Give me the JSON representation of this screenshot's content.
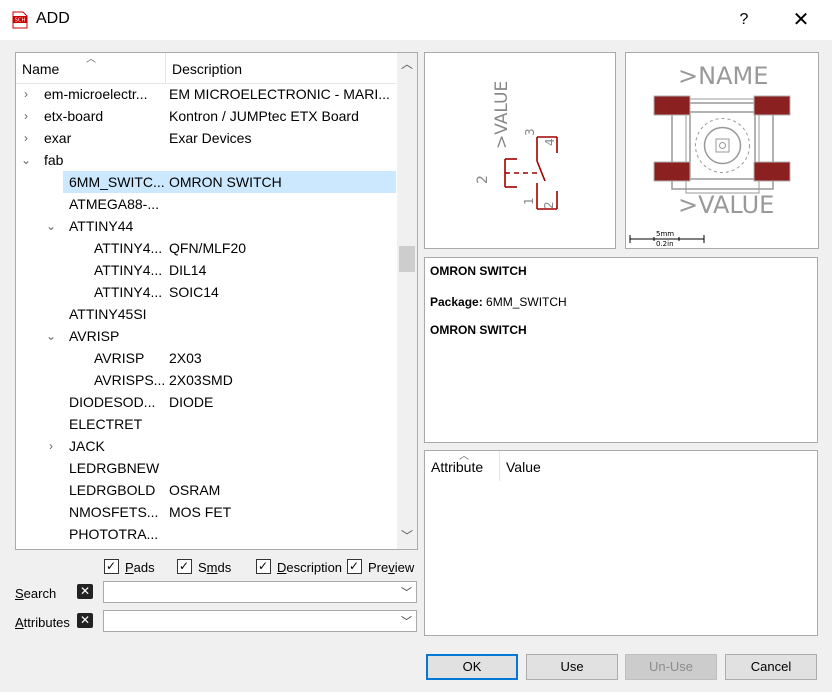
{
  "window": {
    "title": "ADD",
    "help": "?",
    "close": "✕"
  },
  "tree": {
    "col_name": "Name",
    "col_desc": "Description",
    "rows": [
      {
        "name": "em-microelectr...",
        "desc": "EM MICROELECTRONIC - MARI...",
        "indent": 0,
        "exp": "›"
      },
      {
        "name": "etx-board",
        "desc": "Kontron / JUMPtec ETX Board",
        "indent": 0,
        "exp": "›"
      },
      {
        "name": "exar",
        "desc": "Exar Devices",
        "indent": 0,
        "exp": "›"
      },
      {
        "name": "fab",
        "desc": "",
        "indent": 0,
        "exp": "⌄"
      },
      {
        "name": "6MM_SWITC...",
        "desc": "OMRON SWITCH",
        "indent": 1,
        "exp": "",
        "selected": true
      },
      {
        "name": "ATMEGA88-...",
        "desc": "",
        "indent": 1,
        "exp": ""
      },
      {
        "name": "ATTINY44",
        "desc": "",
        "indent": 1,
        "exp": "⌄"
      },
      {
        "name": "ATTINY4...",
        "desc": "QFN/MLF20",
        "indent": 2,
        "exp": ""
      },
      {
        "name": "ATTINY4...",
        "desc": "DIL14",
        "indent": 2,
        "exp": ""
      },
      {
        "name": "ATTINY4...",
        "desc": "SOIC14",
        "indent": 2,
        "exp": ""
      },
      {
        "name": "ATTINY45SI",
        "desc": "",
        "indent": 1,
        "exp": ""
      },
      {
        "name": "AVRISP",
        "desc": "",
        "indent": 1,
        "exp": "⌄"
      },
      {
        "name": "AVRISP",
        "desc": "2X03",
        "indent": 2,
        "exp": ""
      },
      {
        "name": "AVRISPS...",
        "desc": "2X03SMD",
        "indent": 2,
        "exp": ""
      },
      {
        "name": "DIODESOD...",
        "desc": "DIODE",
        "indent": 1,
        "exp": ""
      },
      {
        "name": "ELECTRET",
        "desc": "",
        "indent": 1,
        "exp": ""
      },
      {
        "name": "JACK",
        "desc": "",
        "indent": 1,
        "exp": "›"
      },
      {
        "name": "LEDRGBNEW",
        "desc": "",
        "indent": 1,
        "exp": ""
      },
      {
        "name": "LEDRGBOLD",
        "desc": "OSRAM",
        "indent": 1,
        "exp": ""
      },
      {
        "name": "NMOSFETS...",
        "desc": "MOS FET",
        "indent": 1,
        "exp": ""
      },
      {
        "name": "PHOTOTRA...",
        "desc": "",
        "indent": 1,
        "exp": ""
      }
    ]
  },
  "filters": {
    "pads": "Pads",
    "smds": "Smds",
    "description": "Description",
    "preview": "Preview",
    "pads_u": "P",
    "pads_rest": "ads",
    "smds_pre": "S",
    "smds_u": "m",
    "smds_rest": "ds",
    "desc_u": "D",
    "desc_rest": "escription",
    "prev_pre": "Pre",
    "prev_u": "v",
    "prev_rest": "iew"
  },
  "search": {
    "label_u": "S",
    "label_rest": "earch",
    "value": ""
  },
  "attributes_filter": {
    "label_u": "A",
    "label_rest": "ttributes",
    "value": ""
  },
  "schematic": {
    "value_label": ">VALUE",
    "pin1": "1",
    "pin2": "2",
    "pin3": "3",
    "pin4": "4",
    "side": "2"
  },
  "package_preview": {
    "name_label": ">NAME",
    "value_label": ">VALUE",
    "scale_mm": "5mm",
    "scale_in": "0.2in"
  },
  "info": {
    "title": "OMRON SWITCH",
    "package_label": "Package:",
    "package_value": "6MM_SWITCH",
    "description": "OMRON SWITCH"
  },
  "attr_table": {
    "col_attribute": "Attribute",
    "col_value": "Value"
  },
  "buttons": {
    "ok": "OK",
    "use": "Use",
    "unuse": "Un-Use",
    "cancel": "Cancel"
  },
  "colors": {
    "selection": "#cce8ff",
    "accent": "#0078d7",
    "schematic_red": "#a00000",
    "pad_red": "#8b2020"
  }
}
